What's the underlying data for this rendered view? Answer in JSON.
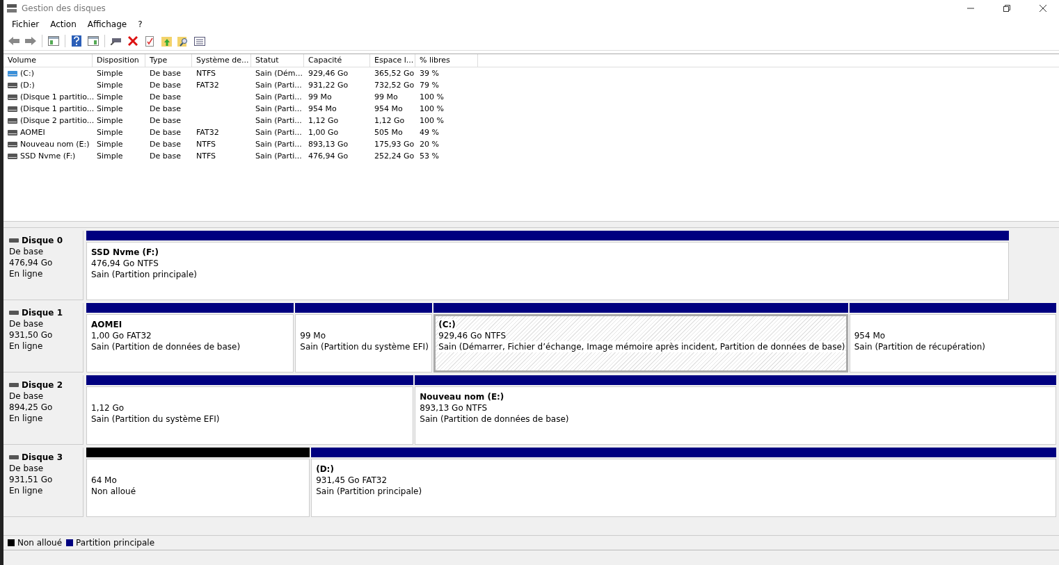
{
  "window": {
    "title": "Gestion des disques"
  },
  "menu": [
    "Fichier",
    "Action",
    "Affichage",
    "?"
  ],
  "table": {
    "columns": [
      "Volume",
      "Disposition",
      "Type",
      "Système de...",
      "Statut",
      "Capacité",
      "Espace l...",
      "% libres"
    ],
    "rows": [
      {
        "kind": "system",
        "cells": [
          "(C:)",
          "Simple",
          "De base",
          "NTFS",
          "Sain (Dém...",
          "929,46 Go",
          "365,52 Go",
          "39 %"
        ]
      },
      {
        "kind": "drive",
        "cells": [
          "(D:)",
          "Simple",
          "De base",
          "FAT32",
          "Sain (Parti...",
          "931,22 Go",
          "732,52 Go",
          "79 %"
        ]
      },
      {
        "kind": "drive",
        "cells": [
          "(Disque 1 partitio...",
          "Simple",
          "De base",
          "",
          "Sain (Parti...",
          "99 Mo",
          "99 Mo",
          "100 %"
        ]
      },
      {
        "kind": "drive",
        "cells": [
          "(Disque 1 partitio...",
          "Simple",
          "De base",
          "",
          "Sain (Parti...",
          "954 Mo",
          "954 Mo",
          "100 %"
        ]
      },
      {
        "kind": "drive",
        "cells": [
          "(Disque 2 partitio...",
          "Simple",
          "De base",
          "",
          "Sain (Parti...",
          "1,12 Go",
          "1,12 Go",
          "100 %"
        ]
      },
      {
        "kind": "drive",
        "cells": [
          "AOMEI",
          "Simple",
          "De base",
          "FAT32",
          "Sain (Parti...",
          "1,00 Go",
          "505 Mo",
          "49 %"
        ]
      },
      {
        "kind": "drive",
        "cells": [
          "Nouveau nom (E:)",
          "Simple",
          "De base",
          "NTFS",
          "Sain (Parti...",
          "893,13 Go",
          "175,93 Go",
          "20 %"
        ]
      },
      {
        "kind": "drive",
        "cells": [
          "SSD Nvme (F:)",
          "Simple",
          "De base",
          "NTFS",
          "Sain (Parti...",
          "476,94 Go",
          "252,24 Go",
          "53 %"
        ]
      }
    ]
  },
  "disks": [
    {
      "name": "Disque 0",
      "type": "De base",
      "size": "476,94 Go",
      "status": "En ligne",
      "partitions": [
        {
          "kind": "primary",
          "selected": false,
          "name": "SSD Nvme  (F:)",
          "size": "476,94 Go NTFS",
          "status": "Sain (Partition principale)"
        }
      ]
    },
    {
      "name": "Disque 1",
      "type": "De base",
      "size": "931,50 Go",
      "status": "En ligne",
      "partitions": [
        {
          "kind": "primary",
          "selected": false,
          "name": "AOMEI",
          "size": "1,00 Go FAT32",
          "status": "Sain (Partition de données de base)"
        },
        {
          "kind": "primary",
          "selected": false,
          "size": "99 Mo",
          "status": "Sain (Partition du système EFI)"
        },
        {
          "kind": "primary",
          "selected": true,
          "name": "(C:)",
          "size": "929,46 Go NTFS",
          "status": "Sain (Démarrer, Fichier d’échange, Image mémoire après incident, Partition de données de base)"
        },
        {
          "kind": "primary",
          "selected": false,
          "size": "954 Mo",
          "status": "Sain (Partition de récupération)"
        }
      ]
    },
    {
      "name": "Disque 2",
      "type": "De base",
      "size": "894,25 Go",
      "status": "En ligne",
      "partitions": [
        {
          "kind": "primary",
          "selected": false,
          "size": "1,12 Go",
          "status": "Sain (Partition du système EFI)"
        },
        {
          "kind": "primary",
          "selected": false,
          "name": "Nouveau nom  (E:)",
          "size": "893,13 Go NTFS",
          "status": "Sain (Partition de données de base)"
        }
      ]
    },
    {
      "name": "Disque 3",
      "type": "De base",
      "size": "931,51 Go",
      "status": "En ligne",
      "partitions": [
        {
          "kind": "unallocated",
          "selected": false,
          "size": "64 Mo",
          "status": "Non alloué"
        },
        {
          "kind": "primary",
          "selected": false,
          "name": "(D:)",
          "size": "931,45 Go FAT32",
          "status": "Sain (Partition principale)"
        }
      ]
    }
  ],
  "legend": [
    {
      "label": "Non alloué",
      "color": "#000000"
    },
    {
      "label": "Partition principale",
      "color": "#000080"
    }
  ]
}
